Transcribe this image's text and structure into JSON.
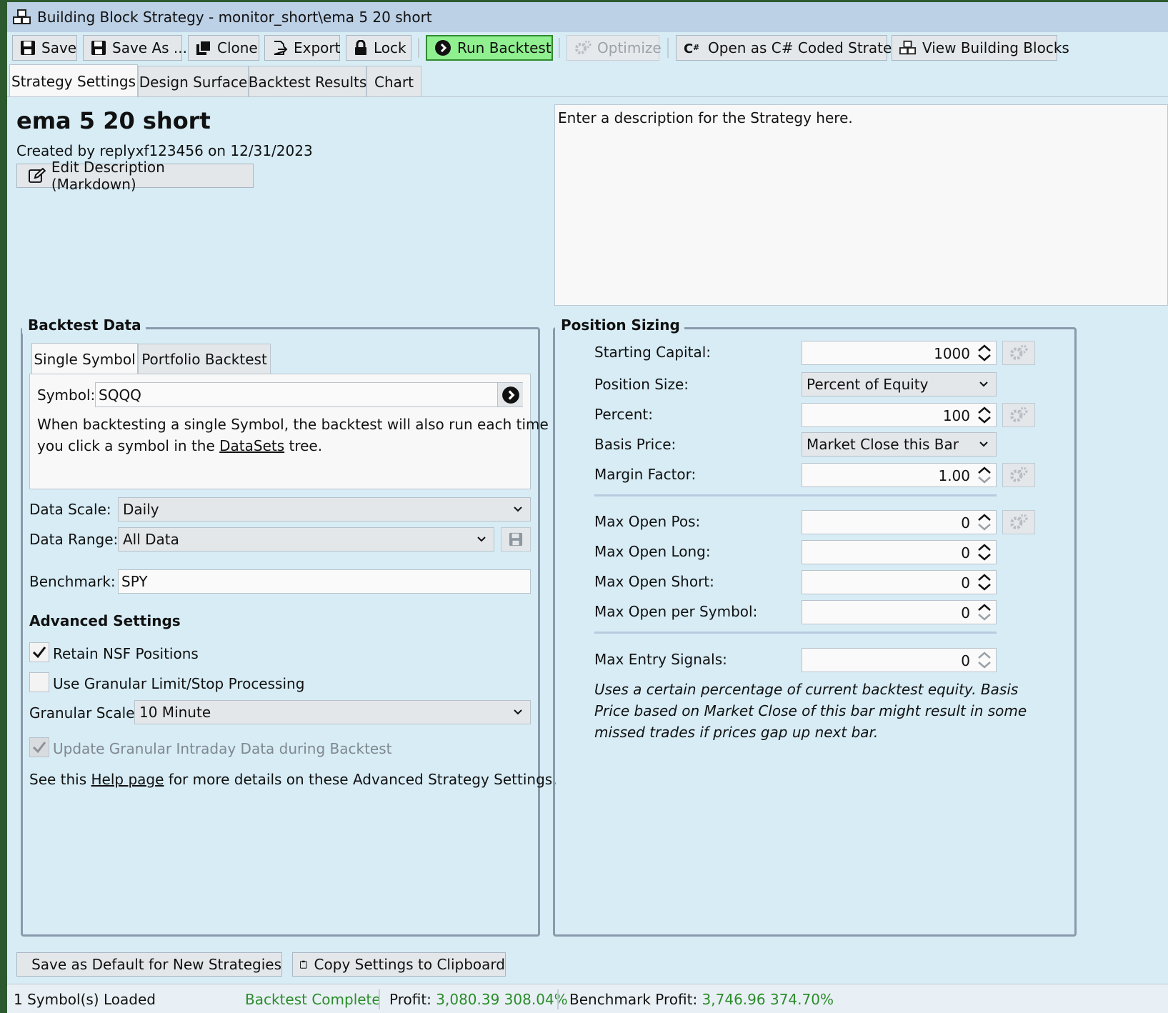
{
  "window": {
    "title": "Building Block Strategy - monitor_short\\ema 5 20 short"
  },
  "toolbar": {
    "save": "Save",
    "save_as": "Save As ...",
    "clone": "Clone",
    "export": "Export",
    "lock": "Lock",
    "run_backtest": "Run Backtest",
    "optimize": "Optimize",
    "open_csharp": "Open as C# Coded Strategy",
    "view_blocks": "View Building Blocks",
    "run_color": "#90f090"
  },
  "tabs": [
    {
      "label": "Strategy Settings",
      "active": true
    },
    {
      "label": "Design Surface",
      "active": false
    },
    {
      "label": "Backtest Results",
      "active": false
    },
    {
      "label": "Chart",
      "active": false
    }
  ],
  "strategy": {
    "name": "ema 5 20 short",
    "created_line": "Created by replyxf123456 on 12/31/2023",
    "edit_description": "Edit Description (Markdown)",
    "description": "Enter a description for the Strategy here."
  },
  "backtest_data": {
    "heading": "Backtest Data",
    "subtabs": [
      {
        "label": "Single Symbol",
        "active": true
      },
      {
        "label": "Portfolio Backtest",
        "active": false
      }
    ],
    "symbol_label": "Symbol:",
    "symbol_value": "SQQQ",
    "help_line1": "When backtesting a single Symbol, the backtest will also run each time",
    "help_line2_pre": "you click a symbol in the ",
    "help_line2_link": "DataSets",
    "help_line2_post": " tree.",
    "data_scale_label": "Data Scale:",
    "data_scale_value": "Daily",
    "data_range_label": "Data Range:",
    "data_range_value": "All Data",
    "benchmark_label": "Benchmark:",
    "benchmark_value": "SPY"
  },
  "advanced": {
    "heading": "Advanced Settings",
    "retain_nsf": {
      "label": "Retain NSF Positions",
      "checked": true
    },
    "granular_processing": {
      "label": "Use Granular Limit/Stop Processing",
      "checked": false
    },
    "granular_scale_label": "Granular Scale",
    "granular_scale_value": "10 Minute",
    "update_granular": {
      "label": "Update Granular Intraday Data during Backtest",
      "checked": true,
      "disabled": true
    },
    "help_pre": "See this ",
    "help_link": "Help page",
    "help_post": " for more details on these Advanced Strategy Settings."
  },
  "position_sizing": {
    "heading": "Position Sizing",
    "starting_capital_label": "Starting Capital:",
    "starting_capital_value": "1000",
    "position_size_label": "Position Size:",
    "position_size_value": "Percent of Equity",
    "percent_label": "Percent:",
    "percent_value": "100",
    "basis_price_label": "Basis Price:",
    "basis_price_value": "Market Close this Bar",
    "margin_factor_label": "Margin Factor:",
    "margin_factor_value": "1.00",
    "max_open_pos_label": "Max Open Pos:",
    "max_open_pos_value": "0",
    "max_open_long_label": "Max Open Long:",
    "max_open_long_value": "0",
    "max_open_short_label": "Max Open Short:",
    "max_open_short_value": "0",
    "max_open_per_symbol_label": "Max Open per Symbol:",
    "max_open_per_symbol_value": "0",
    "max_entry_signals_label": "Max Entry Signals:",
    "max_entry_signals_value": "0",
    "note_line1": "Uses a certain percentage of current backtest equity. Basis",
    "note_line2": "Price based on Market Close of this bar might result in some",
    "note_line3": "missed trades if prices gap up next bar."
  },
  "bottom": {
    "save_default": "Save as Default for New Strategies",
    "copy_settings": "Copy Settings to Clipboard"
  },
  "status": {
    "symbols_loaded": "1 Symbol(s) Loaded",
    "backtest_state": "Backtest Complete",
    "profit_label": "Profit:",
    "profit_value": "3,080.39 308.04%",
    "benchmark_label": "Benchmark Profit:",
    "benchmark_value": "3,746.96 374.70%",
    "good_color": "#2a8c2a"
  }
}
